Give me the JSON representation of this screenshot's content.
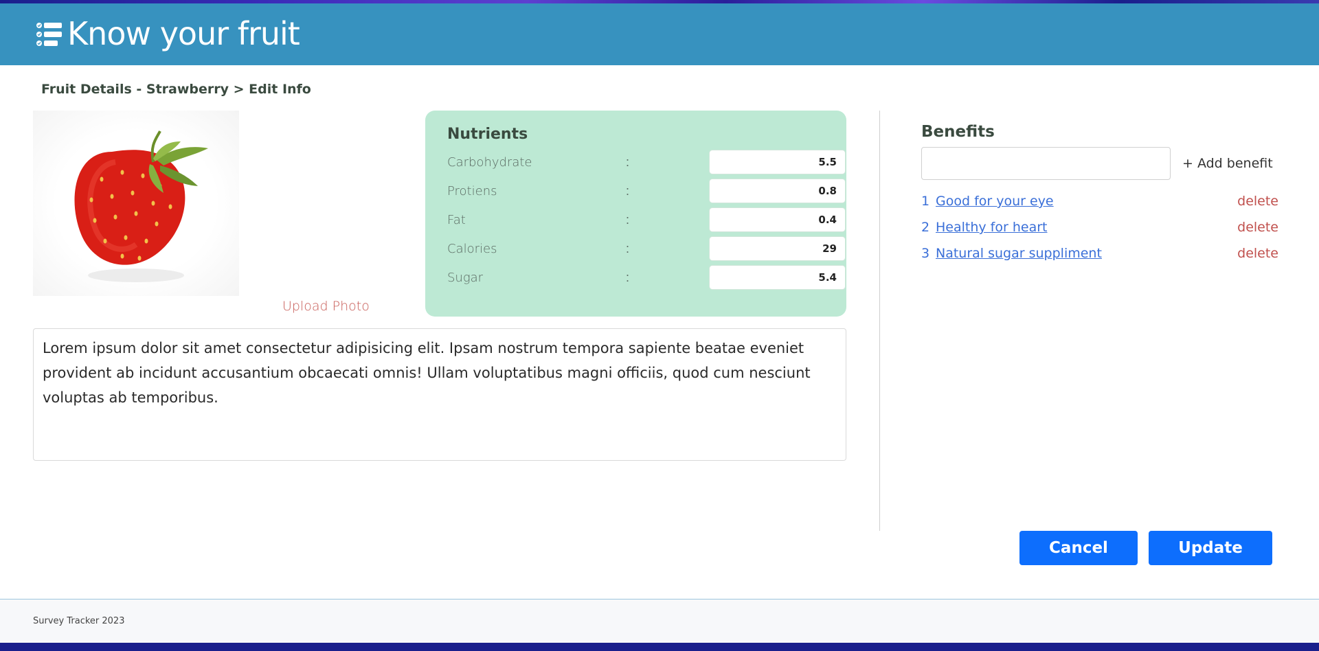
{
  "header": {
    "title": "Know your fruit",
    "logo_icon": "checklist-icon",
    "background_color": "#3792bf"
  },
  "breadcrumb": "Fruit Details - Strawberry > Edit Info",
  "photo": {
    "upload_label": "Upload Photo"
  },
  "nutrients": {
    "title": "Nutrients",
    "items": [
      {
        "label": "Carbohydrate",
        "separator": ":",
        "value": "5.5"
      },
      {
        "label": "Protiens",
        "separator": ":",
        "value": "0.8"
      },
      {
        "label": "Fat",
        "separator": ":",
        "value": "0.4"
      },
      {
        "label": "Calories",
        "separator": ":",
        "value": "29"
      },
      {
        "label": "Sugar",
        "separator": ":",
        "value": "5.4"
      }
    ]
  },
  "description": "Lorem ipsum dolor sit amet consectetur adipisicing elit. Ipsam nostrum tempora sapiente beatae eveniet provident ab incidunt accusantium obcaecati omnis! Ullam voluptatibus magni officiis, quod cum nesciunt voluptas ab temporibus.",
  "benefits": {
    "title": "Benefits",
    "input_value": "",
    "add_label": "+ Add benefit",
    "items": [
      {
        "number": "1",
        "text": "Good for your eye",
        "delete_label": "delete"
      },
      {
        "number": "2",
        "text": "Healthy for heart",
        "delete_label": "delete"
      },
      {
        "number": "3",
        "text": "Natural sugar suppliment",
        "delete_label": "delete"
      }
    ]
  },
  "actions": {
    "cancel_label": "Cancel",
    "update_label": "Update",
    "button_color": "#0d6efd"
  },
  "footer": {
    "text": "Survey Tracker 2023"
  }
}
